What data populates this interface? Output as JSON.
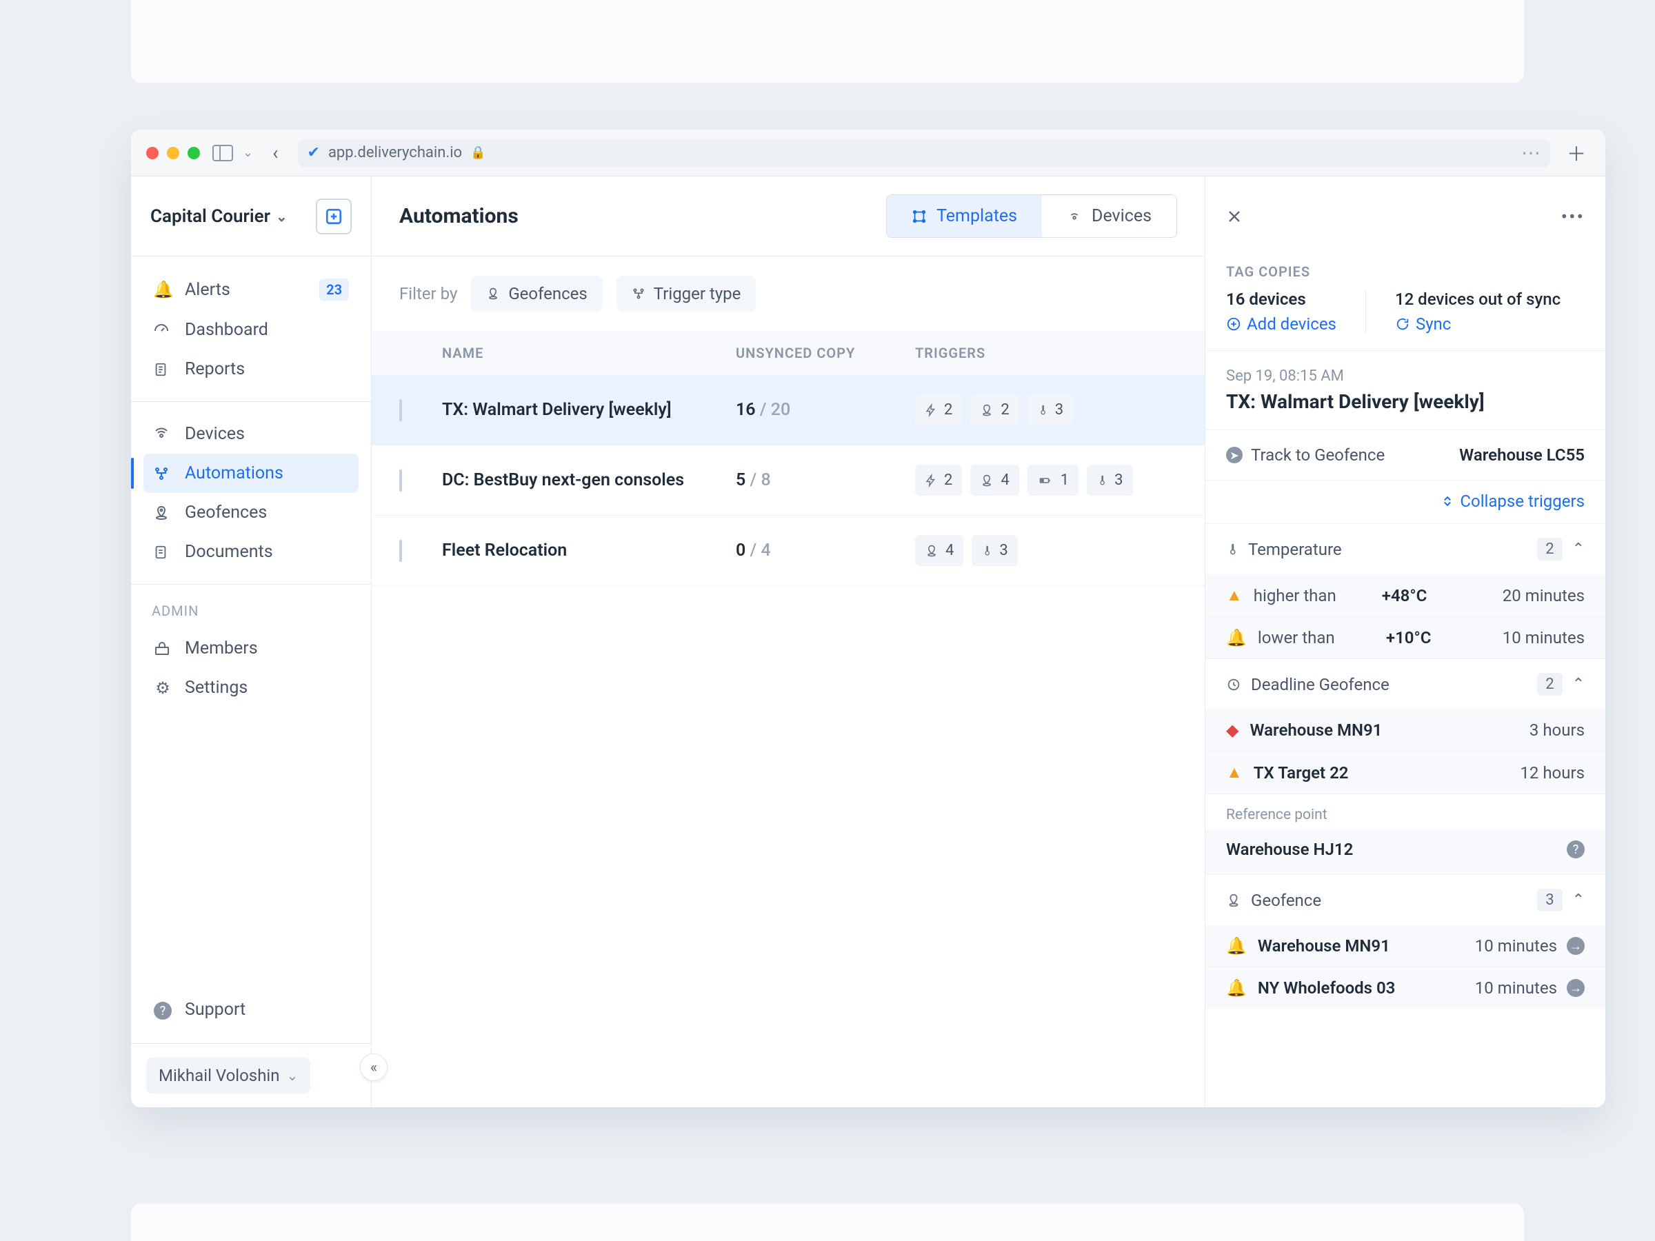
{
  "browser": {
    "url": "app.deliverychain.io"
  },
  "org": {
    "name": "Capital Courier"
  },
  "nav": {
    "primary": [
      {
        "label": "Alerts",
        "badge": "23"
      },
      {
        "label": "Dashboard"
      },
      {
        "label": "Reports"
      }
    ],
    "secondary": [
      {
        "label": "Devices"
      },
      {
        "label": "Automations"
      },
      {
        "label": "Geofences"
      },
      {
        "label": "Documents"
      }
    ],
    "admin_header": "ADMIN",
    "admin": [
      {
        "label": "Members"
      },
      {
        "label": "Settings"
      }
    ],
    "support": "Support"
  },
  "user": {
    "name": "Mikhail Voloshin"
  },
  "page": {
    "title": "Automations",
    "tabs": {
      "templates": "Templates",
      "devices": "Devices"
    }
  },
  "filters": {
    "label": "Filter by",
    "geofences": "Geofences",
    "trigger_type": "Trigger type"
  },
  "table": {
    "headers": {
      "name": "NAME",
      "unsynced": "UNSYNCED COPY",
      "triggers": "TRIGGERS"
    },
    "rows": [
      {
        "name": "TX: Walmart Delivery [weekly]",
        "unsynced": "16",
        "total": "20",
        "triggers": [
          {
            "icon": "bolt",
            "count": "2"
          },
          {
            "icon": "geo",
            "count": "2"
          },
          {
            "icon": "temp",
            "count": "3"
          }
        ],
        "selected": true
      },
      {
        "name": "DC: BestBuy next-gen consoles",
        "unsynced": "5",
        "total": "8",
        "triggers": [
          {
            "icon": "bolt",
            "count": "2"
          },
          {
            "icon": "geo",
            "count": "4"
          },
          {
            "icon": "battery",
            "count": "1"
          },
          {
            "icon": "temp",
            "count": "3"
          }
        ]
      },
      {
        "name": "Fleet Relocation",
        "unsynced": "0",
        "total": "4",
        "triggers": [
          {
            "icon": "geo",
            "count": "4"
          },
          {
            "icon": "temp",
            "count": "3"
          }
        ]
      }
    ]
  },
  "panel": {
    "tag_header": "TAG COPIES",
    "devices_stat": "16 devices",
    "out_of_sync": "12 devices out of sync",
    "add_devices": "Add devices",
    "sync": "Sync",
    "timestamp": "Sep 19, 08:15 AM",
    "title": "TX: Walmart Delivery [weekly]",
    "track_label": "Track to Geofence",
    "track_value": "Warehouse LC55",
    "collapse": "Collapse triggers",
    "groups": {
      "temperature": {
        "title": "Temperature",
        "count": "2",
        "items": [
          {
            "sev": "warn",
            "label": "higher than",
            "value": "+48°C",
            "right": "20 minutes"
          },
          {
            "sev": "info",
            "label": "lower than",
            "value": "+10°C",
            "right": "10 minutes"
          }
        ]
      },
      "deadline": {
        "title": "Deadline Geofence",
        "count": "2",
        "items": [
          {
            "sev": "danger",
            "value": "Warehouse MN91",
            "right": "3 hours"
          },
          {
            "sev": "warn",
            "value": "TX Target 22",
            "right": "12 hours"
          }
        ]
      },
      "reference": {
        "label": "Reference point",
        "value": "Warehouse HJ12"
      },
      "geofence": {
        "title": "Geofence",
        "count": "3",
        "items": [
          {
            "sev": "info",
            "value": "Warehouse MN91",
            "right": "10 minutes",
            "arrow": true
          },
          {
            "sev": "info",
            "value": "NY Wholefoods 03",
            "right": "10 minutes",
            "arrow": true
          }
        ]
      }
    }
  }
}
